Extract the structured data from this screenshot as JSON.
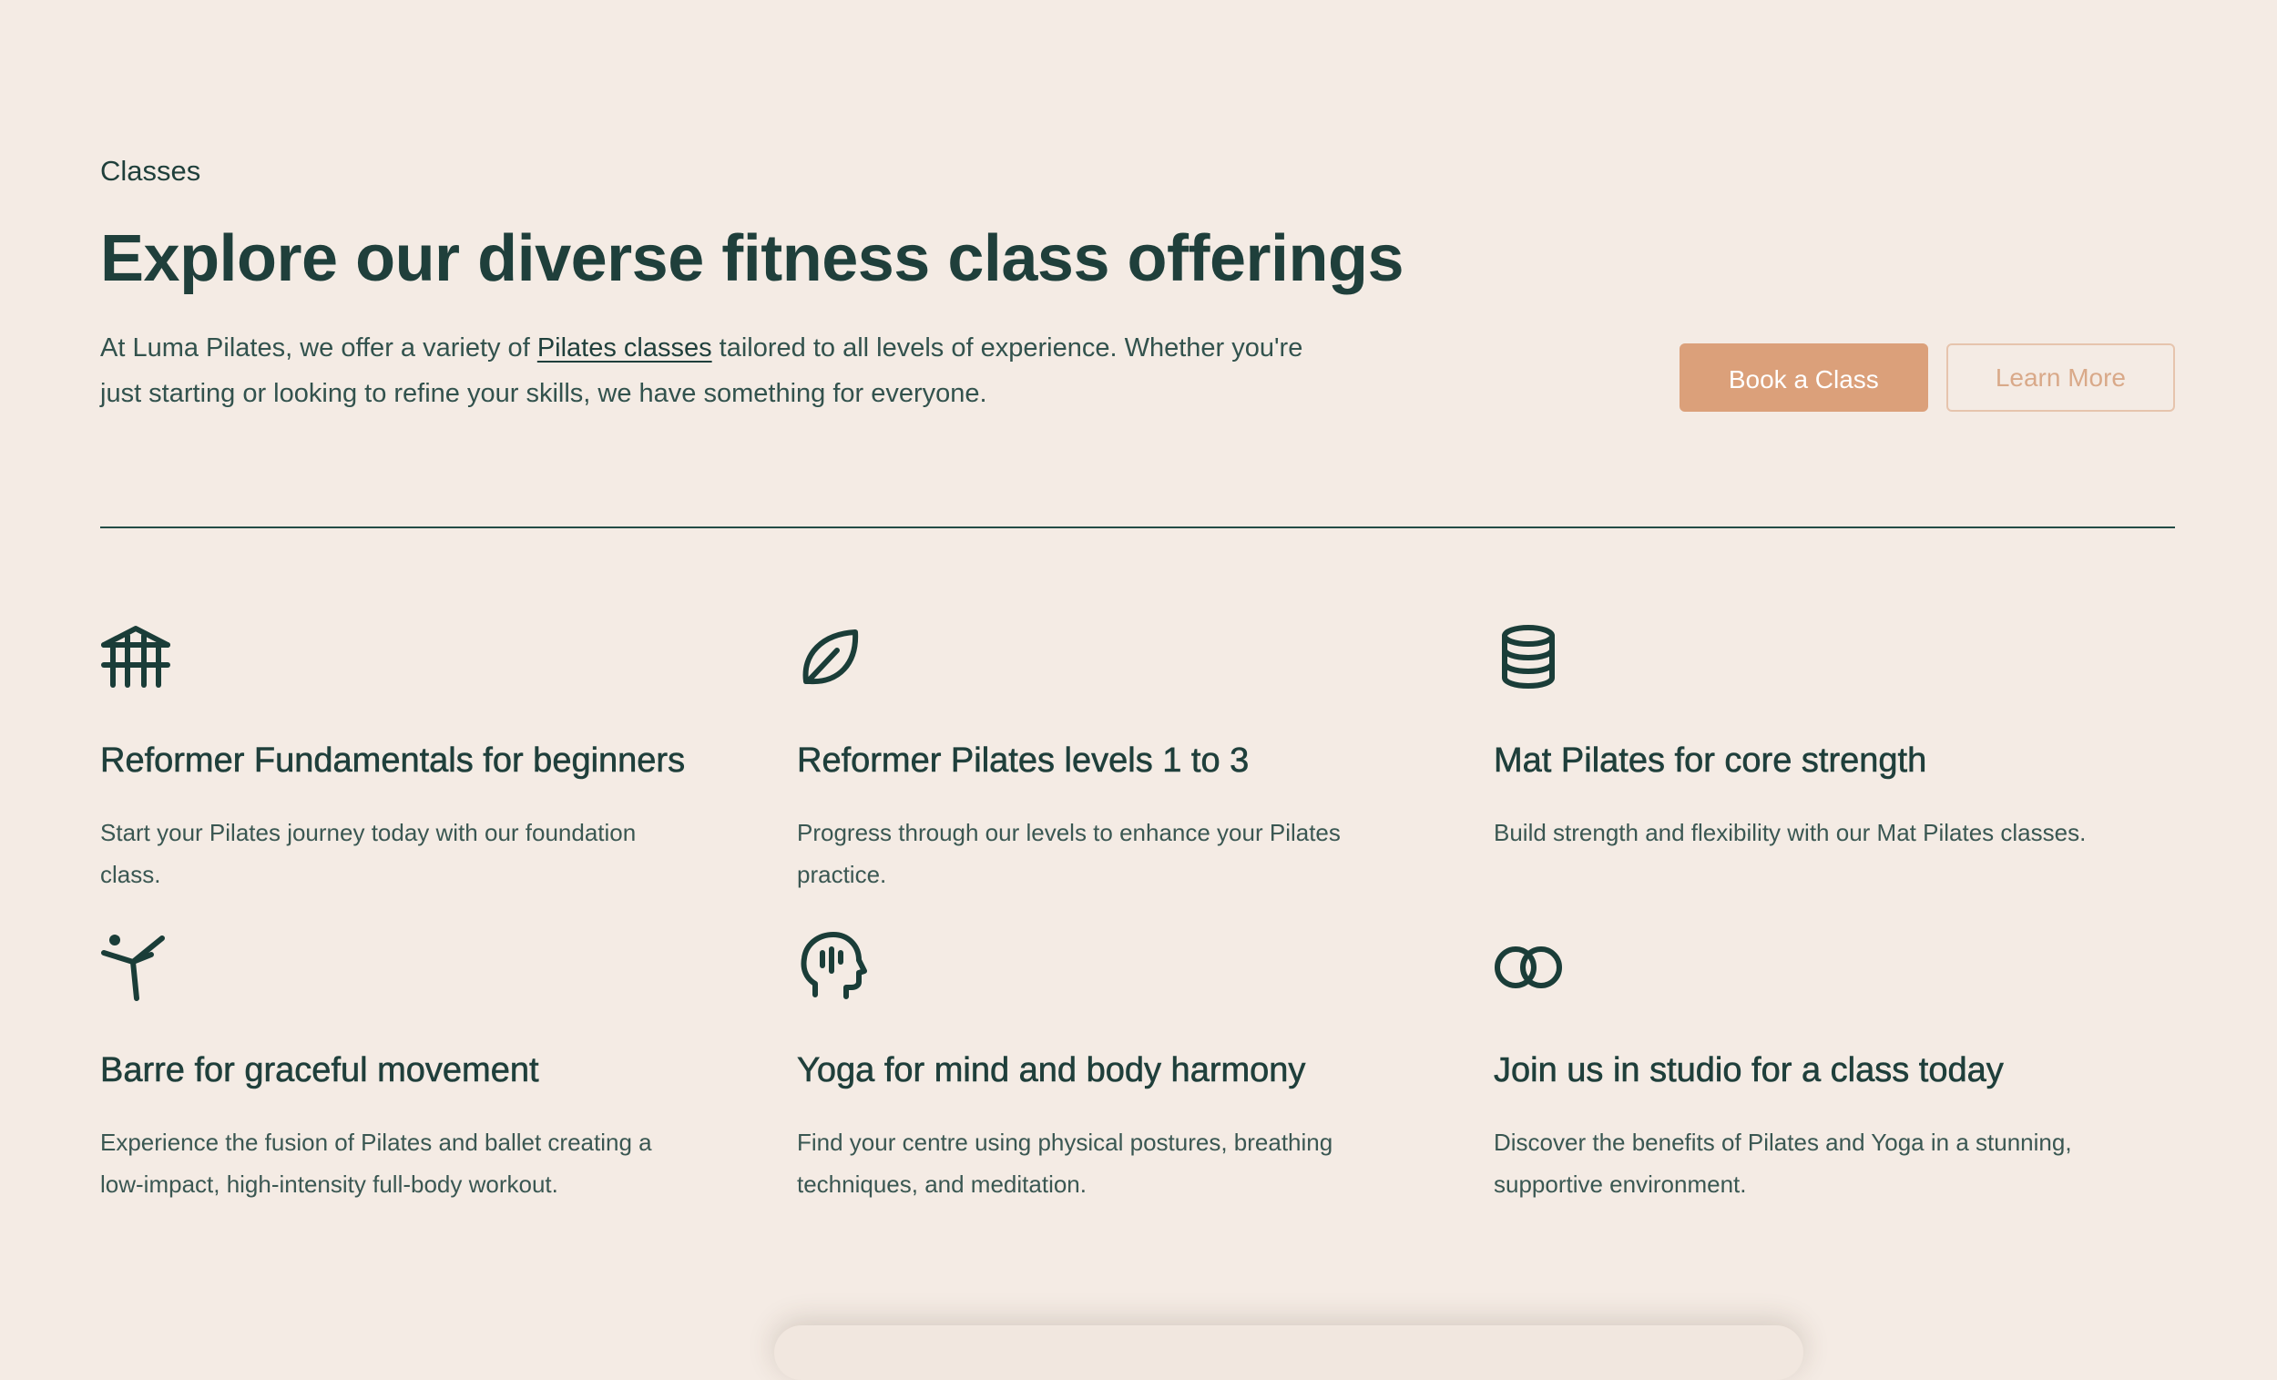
{
  "section": {
    "eyebrow": "Classes",
    "title": "Explore our diverse fitness class offerings",
    "description_before": "At Luma Pilates, we offer a variety of ",
    "description_link": "Pilates classes",
    "description_after": " tailored to all levels of experience. Whether you're just starting or looking to refine your skills, we have something for everyone.",
    "primary_button": "Book a Class",
    "secondary_button": "Learn More"
  },
  "classes": [
    {
      "icon": "pavilion-icon",
      "title": "Reformer Fundamentals for beginners",
      "text": "Start your Pilates journey today with our foundation class."
    },
    {
      "icon": "leaf-icon",
      "title": "Reformer Pilates levels 1 to 3",
      "text": "Progress through our levels to enhance your Pilates practice."
    },
    {
      "icon": "database-icon",
      "title": "Mat Pilates for core strength",
      "text": "Build strength and flexibility with our Mat Pilates classes."
    },
    {
      "icon": "stretching-figure-icon",
      "title": "Barre for graceful movement",
      "text": "Experience the fusion of Pilates and ballet creating a low-impact, high-intensity full-body workout."
    },
    {
      "icon": "head-mind-icon",
      "title": "Yoga for mind and body harmony",
      "text": "Find your centre using physical postures, breathing techniques, and meditation."
    },
    {
      "icon": "interlocking-rings-icon",
      "title": "Join us in studio for a class today",
      "text": "Discover the benefits of Pilates and Yoga in a stunning, supportive environment."
    }
  ],
  "colors": {
    "background": "#f4ebe4",
    "text": "#1f3f3b",
    "accent": "#dba07a",
    "secondary_border": "#e6c4ad"
  }
}
